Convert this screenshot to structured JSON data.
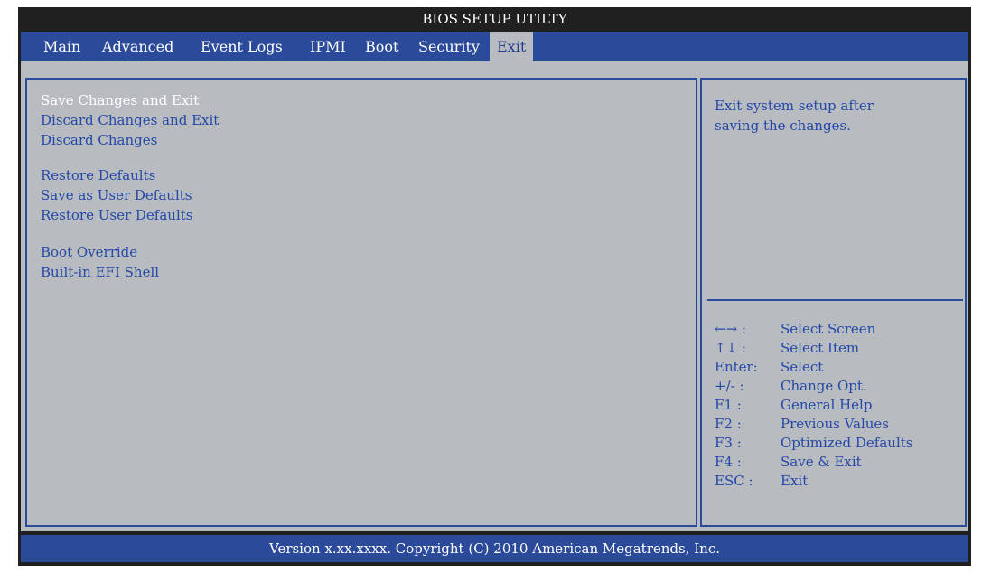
{
  "window": {
    "title": "BIOS SETUP UTILTY"
  },
  "tabs": [
    {
      "label": "Main"
    },
    {
      "label": "Advanced"
    },
    {
      "label": "Event Logs"
    },
    {
      "label": "IPMI"
    },
    {
      "label": "Boot"
    },
    {
      "label": "Security"
    },
    {
      "label": "Exit",
      "active": true
    }
  ],
  "menu": {
    "items": [
      {
        "label": "Save Changes and Exit",
        "selected": true
      },
      {
        "label": "Discard Changes and Exit"
      },
      {
        "label": "Discard Changes"
      },
      {
        "label": "Restore Defaults"
      },
      {
        "label": "Save as User Defaults"
      },
      {
        "label": "Restore User Defaults"
      },
      {
        "label": "Boot Override"
      },
      {
        "label": "Built-in EFI Shell"
      }
    ]
  },
  "help": {
    "line1": "Exit system setup after",
    "line2": "saving the changes."
  },
  "keys": [
    {
      "key": "←→ :",
      "desc": "Select Screen"
    },
    {
      "key": "↑↓  :",
      "desc": "Select Item"
    },
    {
      "key": "Enter:",
      "desc": "Select"
    },
    {
      "key": "+/- :",
      "desc": "Change Opt."
    },
    {
      "key": "F1 :",
      "desc": "General Help"
    },
    {
      "key": "F2 :",
      "desc": "Previous Values"
    },
    {
      "key": "F3 :",
      "desc": "Optimized Defaults"
    },
    {
      "key": "F4 :",
      "desc": "Save & Exit"
    },
    {
      "key": "ESC :",
      "desc": "Exit"
    }
  ],
  "status": {
    "text": "Version x.xx.xxxx. Copyright (C) 2010 American Megatrends, Inc."
  },
  "colors": {
    "accent_blue": "#2b4a9a",
    "panel_gray": "#b8bbbf",
    "text_blue": "#2348a8",
    "frame_dark": "#202020"
  }
}
